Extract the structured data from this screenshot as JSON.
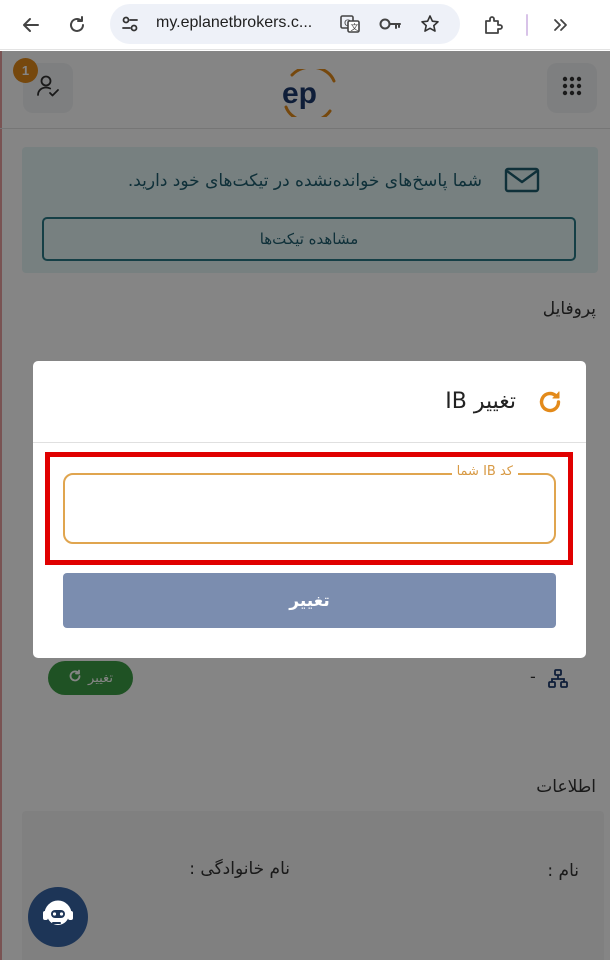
{
  "browser": {
    "url": "my.eplanetbrokers.c...",
    "icons": [
      "back-arrow-icon",
      "reload-icon",
      "site-settings-icon",
      "translate-icon",
      "password-key-icon",
      "bookmark-star-icon",
      "extensions-icon",
      "more-chevrons-icon"
    ]
  },
  "header": {
    "notification_count": "1",
    "logo_text": "ep",
    "icons": [
      "user-check-icon",
      "apps-grid-icon"
    ]
  },
  "alert": {
    "message": "شما پاسخ‌های خوانده‌نشده در تیکت‌های خود دارید.",
    "button_label": "مشاهده تیکت‌ها"
  },
  "sections": {
    "profile_title": "پروفایل",
    "info_title": "اطلاعات"
  },
  "profile": {
    "ib_value": "-",
    "change_label": "تغییر"
  },
  "info": {
    "name_label": "نام :",
    "family_label": "نام خانوادگی :"
  },
  "modal": {
    "title": "تغییر IB",
    "field_label": "کد IB شما",
    "field_value": "",
    "submit_label": "تغییر"
  },
  "colors": {
    "accent_orange": "#e38a1a",
    "teal": "#1d5d6e",
    "submit_button": "#7b8daf",
    "highlight_red": "#e00000",
    "chip_green": "#3d9e45",
    "chat_fab": "#1d3557"
  }
}
